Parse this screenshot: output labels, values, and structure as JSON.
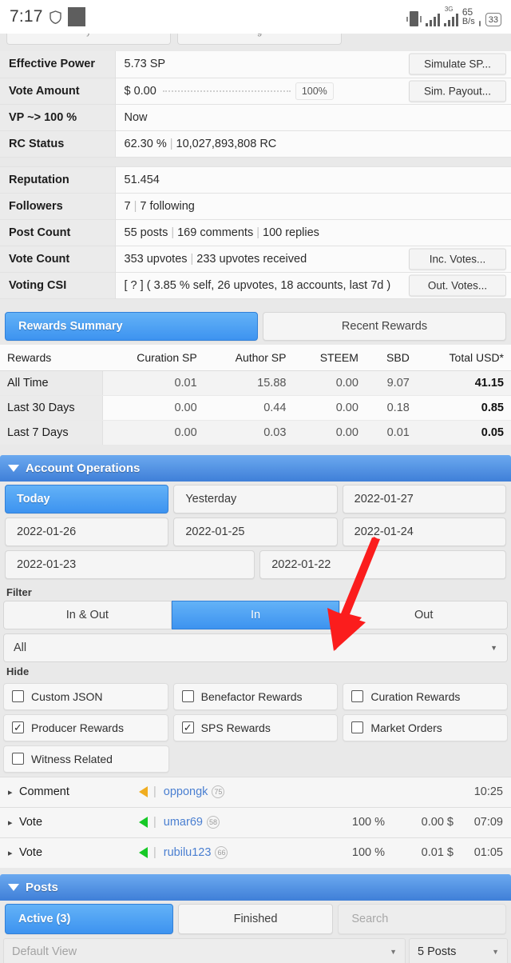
{
  "statusbar": {
    "time": "7:17",
    "shield_icon": "shield-icon",
    "square_icon": "square-block-icon",
    "vibrate_icon": "vibrate-icon",
    "signal_icon": "signal-bars-icon",
    "network_type": "3G",
    "network_speed_value": "65",
    "network_speed_unit": "B/s",
    "battery_level": "33"
  },
  "info_rows": [
    {
      "label": "Effective Power",
      "value": "5.73 SP",
      "button": "Simulate SP..."
    },
    {
      "label": "Vote Amount",
      "value": "$ 0.00",
      "percent": "100%",
      "button": "Sim. Payout..."
    },
    {
      "label": "VP ~> 100 %",
      "value": "Now"
    },
    {
      "label": "RC Status",
      "value": "62.30 %",
      "value2": "10,027,893,808 RC"
    },
    {
      "label": "Reputation",
      "value": "51.454"
    },
    {
      "label": "Followers",
      "value": "7",
      "value2": "7 following"
    },
    {
      "label": "Post Count",
      "value": "55 posts",
      "value2": "169 comments",
      "value3": "100 replies"
    },
    {
      "label": "Vote Count",
      "value": "353 upvotes",
      "value2": "233 upvotes received",
      "button": "Inc. Votes..."
    },
    {
      "label": "Voting CSI",
      "value": "[ ? ] ( 3.85 % self, 26 upvotes, 18 accounts, last 7d )",
      "button": "Out. Votes..."
    }
  ],
  "rewards": {
    "tabs": [
      {
        "label": "Rewards Summary",
        "active": true
      },
      {
        "label": "Recent Rewards",
        "active": false
      }
    ],
    "headers": [
      "Rewards",
      "Curation SP",
      "Author SP",
      "STEEM",
      "SBD",
      "Total USD*"
    ],
    "rows": [
      {
        "period": "All Time",
        "curation_sp": "0.01",
        "author_sp": "15.88",
        "steem": "0.00",
        "sbd": "9.07",
        "total_usd": "41.15"
      },
      {
        "period": "Last 30 Days",
        "curation_sp": "0.00",
        "author_sp": "0.44",
        "steem": "0.00",
        "sbd": "0.18",
        "total_usd": "0.85"
      },
      {
        "period": "Last 7 Days",
        "curation_sp": "0.00",
        "author_sp": "0.03",
        "steem": "0.00",
        "sbd": "0.01",
        "total_usd": "0.05"
      }
    ]
  },
  "account_operations": {
    "header": "Account Operations",
    "dates_row1": [
      {
        "label": "Today",
        "active": true
      },
      {
        "label": "Yesterday",
        "active": false
      },
      {
        "label": "2022-01-27",
        "active": false
      }
    ],
    "dates_row2": [
      {
        "label": "2022-01-26",
        "active": false
      },
      {
        "label": "2022-01-25",
        "active": false
      },
      {
        "label": "2022-01-24",
        "active": false
      }
    ],
    "dates_row3": [
      {
        "label": "2022-01-23",
        "active": false
      },
      {
        "label": "2022-01-22",
        "active": false
      }
    ],
    "filter_label": "Filter",
    "filter_segments": [
      {
        "label": "In & Out",
        "active": false
      },
      {
        "label": "In",
        "active": true
      },
      {
        "label": "Out",
        "active": false
      }
    ],
    "filter_select": "All",
    "hide_label": "Hide",
    "hide_options": [
      {
        "label": "Custom JSON",
        "checked": false
      },
      {
        "label": "Benefactor Rewards",
        "checked": false
      },
      {
        "label": "Curation Rewards",
        "checked": false
      },
      {
        "label": "Producer Rewards",
        "checked": true
      },
      {
        "label": "SPS Rewards",
        "checked": true
      },
      {
        "label": "Market Orders",
        "checked": false
      },
      {
        "label": "Witness Related",
        "checked": false
      }
    ],
    "operations": [
      {
        "type": "Comment",
        "direction_color": "#f0ad20",
        "user": "oppongk",
        "reputation": "75",
        "percent": "",
        "amount": "",
        "time": "10:25"
      },
      {
        "type": "Vote",
        "direction_color": "#17c927",
        "user": "umar69",
        "reputation": "58",
        "percent": "100 %",
        "amount": "0.00 $",
        "time": "07:09"
      },
      {
        "type": "Vote",
        "direction_color": "#17c927",
        "user": "rubilu123",
        "reputation": "66",
        "percent": "100 %",
        "amount": "0.01 $",
        "time": "01:05"
      }
    ]
  },
  "posts": {
    "header": "Posts",
    "tabs": [
      {
        "label": "Active (3)",
        "active": true
      },
      {
        "label": "Finished",
        "active": false
      }
    ],
    "search_placeholder": "Search",
    "view_select": "Default View",
    "count_select": "5 Posts"
  },
  "annotation": {
    "arrow_color": "#fb1d1d",
    "arrow_target": "in-filter-button"
  }
}
